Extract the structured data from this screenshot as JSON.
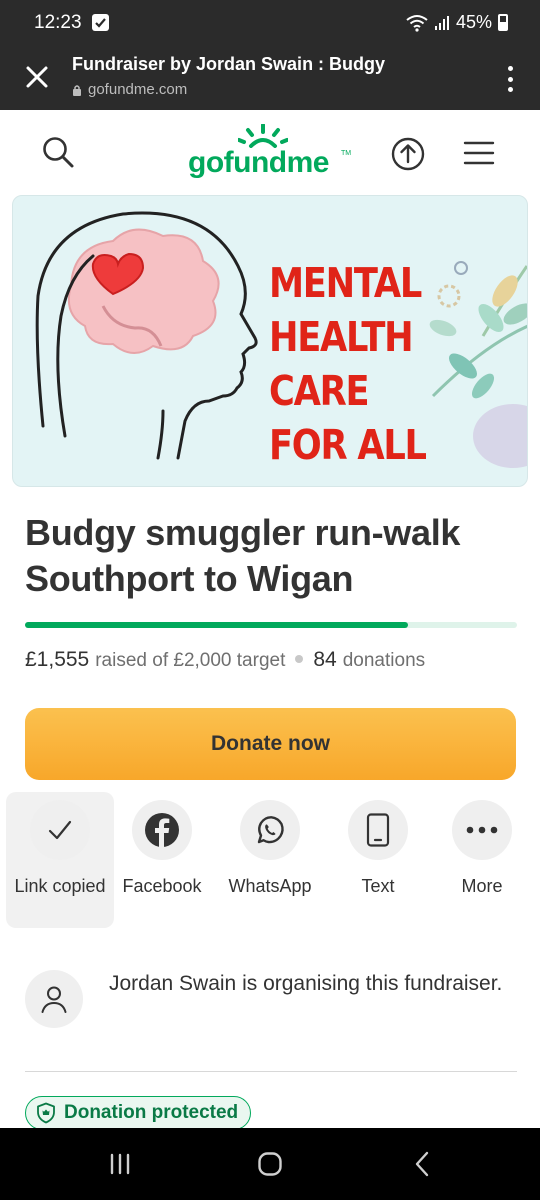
{
  "status_bar": {
    "time": "12:23",
    "battery": "45%"
  },
  "tab": {
    "title": "Fundraiser by Jordan Swain : Budgy",
    "url": "gofundme.com"
  },
  "site": {
    "logo": "gofundme",
    "logo_tm": "TM"
  },
  "hero": {
    "lines": [
      "MENTAL",
      "HEALTH",
      "CARE",
      "FOR ALL"
    ]
  },
  "campaign": {
    "title": "Budgy smuggler run-walk Southport to Wigan",
    "raised": "£1,555",
    "raised_label": "raised of £2,000 target",
    "donations_count": "84",
    "donations_label": "donations",
    "progress_fraction": 0.7775
  },
  "donate_button": "Donate now",
  "share_options": [
    {
      "label": "Link copied",
      "icon": "check-icon"
    },
    {
      "label": "Facebook",
      "icon": "facebook-icon"
    },
    {
      "label": "WhatsApp",
      "icon": "whatsapp-icon"
    },
    {
      "label": "Text",
      "icon": "phone-icon"
    },
    {
      "label": "More",
      "icon": "more-icon"
    }
  ],
  "organiser": {
    "text": "Jordan Swain is organising this fundraiser."
  },
  "protection_badge": "Donation protected",
  "colors": {
    "brand_green": "#02a95c",
    "donate_orange": "#f8a72a",
    "hero_red": "#e02418"
  }
}
